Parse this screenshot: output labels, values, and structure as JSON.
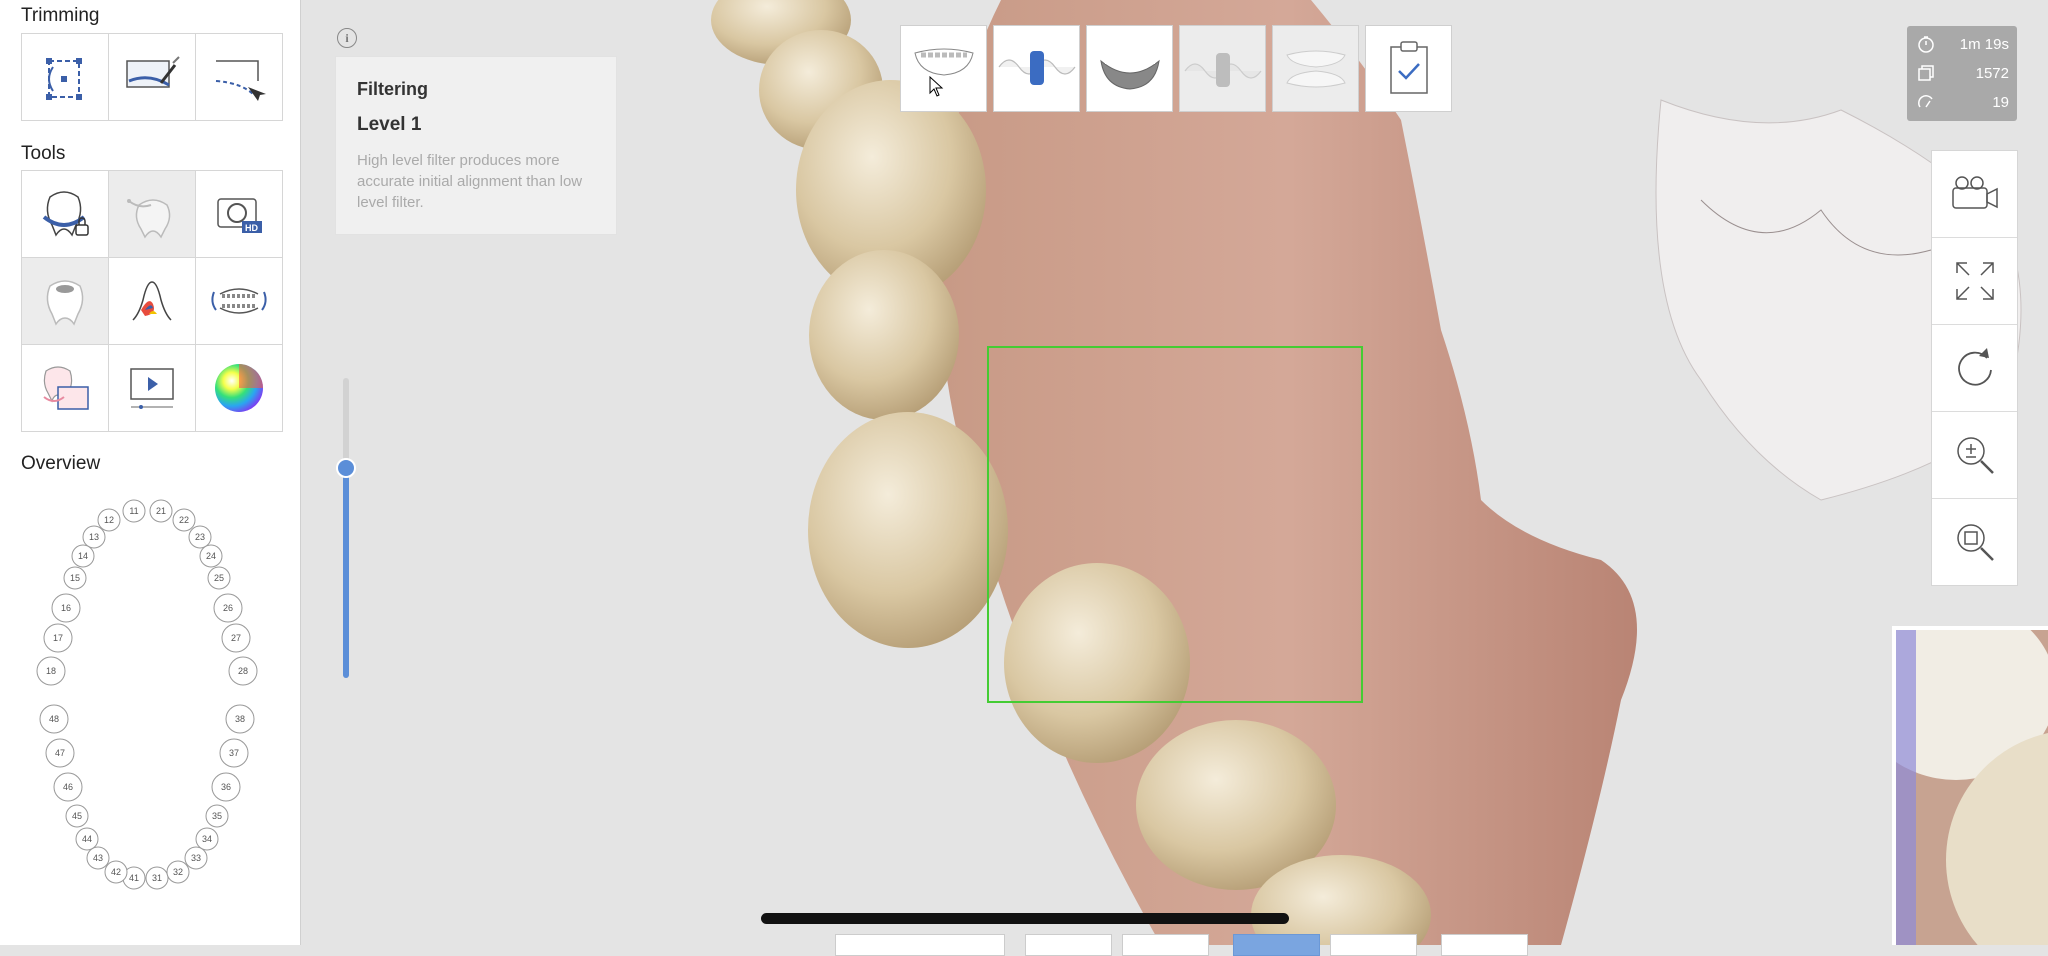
{
  "sidebar": {
    "trimming_title": "Trimming",
    "tools_title": "Tools",
    "overview_title": "Overview",
    "trimming_tools": [
      {
        "name": "select-trim-icon"
      },
      {
        "name": "brush-trim-icon"
      },
      {
        "name": "lasso-trim-icon"
      }
    ],
    "tools": [
      {
        "name": "lock-tooth-icon"
      },
      {
        "name": "tooth-margin-icon"
      },
      {
        "name": "hd-photo-icon"
      },
      {
        "name": "tooth-scan-icon"
      },
      {
        "name": "undercut-icon"
      },
      {
        "name": "bite-align-icon"
      },
      {
        "name": "overlay-image-icon"
      },
      {
        "name": "play-video-icon"
      },
      {
        "name": "color-wheel-icon"
      }
    ],
    "overview_teeth": [
      "11",
      "12",
      "13",
      "14",
      "15",
      "16",
      "17",
      "18",
      "21",
      "22",
      "23",
      "24",
      "25",
      "26",
      "27",
      "28",
      "31",
      "32",
      "33",
      "34",
      "35",
      "36",
      "37",
      "38",
      "41",
      "42",
      "43",
      "44",
      "45",
      "46",
      "47",
      "48"
    ]
  },
  "workflow_steps": [
    {
      "name": "step-maxilla-scan",
      "state": "active"
    },
    {
      "name": "step-maxilla-abutment",
      "state": "normal"
    },
    {
      "name": "step-mandible-scan",
      "state": "normal"
    },
    {
      "name": "step-mandible-abutment",
      "state": "dimmed"
    },
    {
      "name": "step-occlusion",
      "state": "dimmed"
    },
    {
      "name": "step-review",
      "state": "normal"
    }
  ],
  "info_panel": {
    "title": "Filtering",
    "level": "Level 1",
    "description": "High level filter produces more accurate initial alignment than low level filter."
  },
  "stats": {
    "time": "1m 19s",
    "frames": "1572",
    "speed": "19"
  },
  "filter_slider": {
    "level_fraction": 0.7
  },
  "right_toolbar": [
    "camera-view-icon",
    "fit-screen-icon",
    "reset-rotation-icon",
    "zoom-icon",
    "zoom-window-icon"
  ],
  "colors": {
    "accent": "#7aa5e0",
    "slider": "#5b8ed8",
    "scan_box": "#44cc33",
    "stats_bg": "#a9a9a9"
  }
}
